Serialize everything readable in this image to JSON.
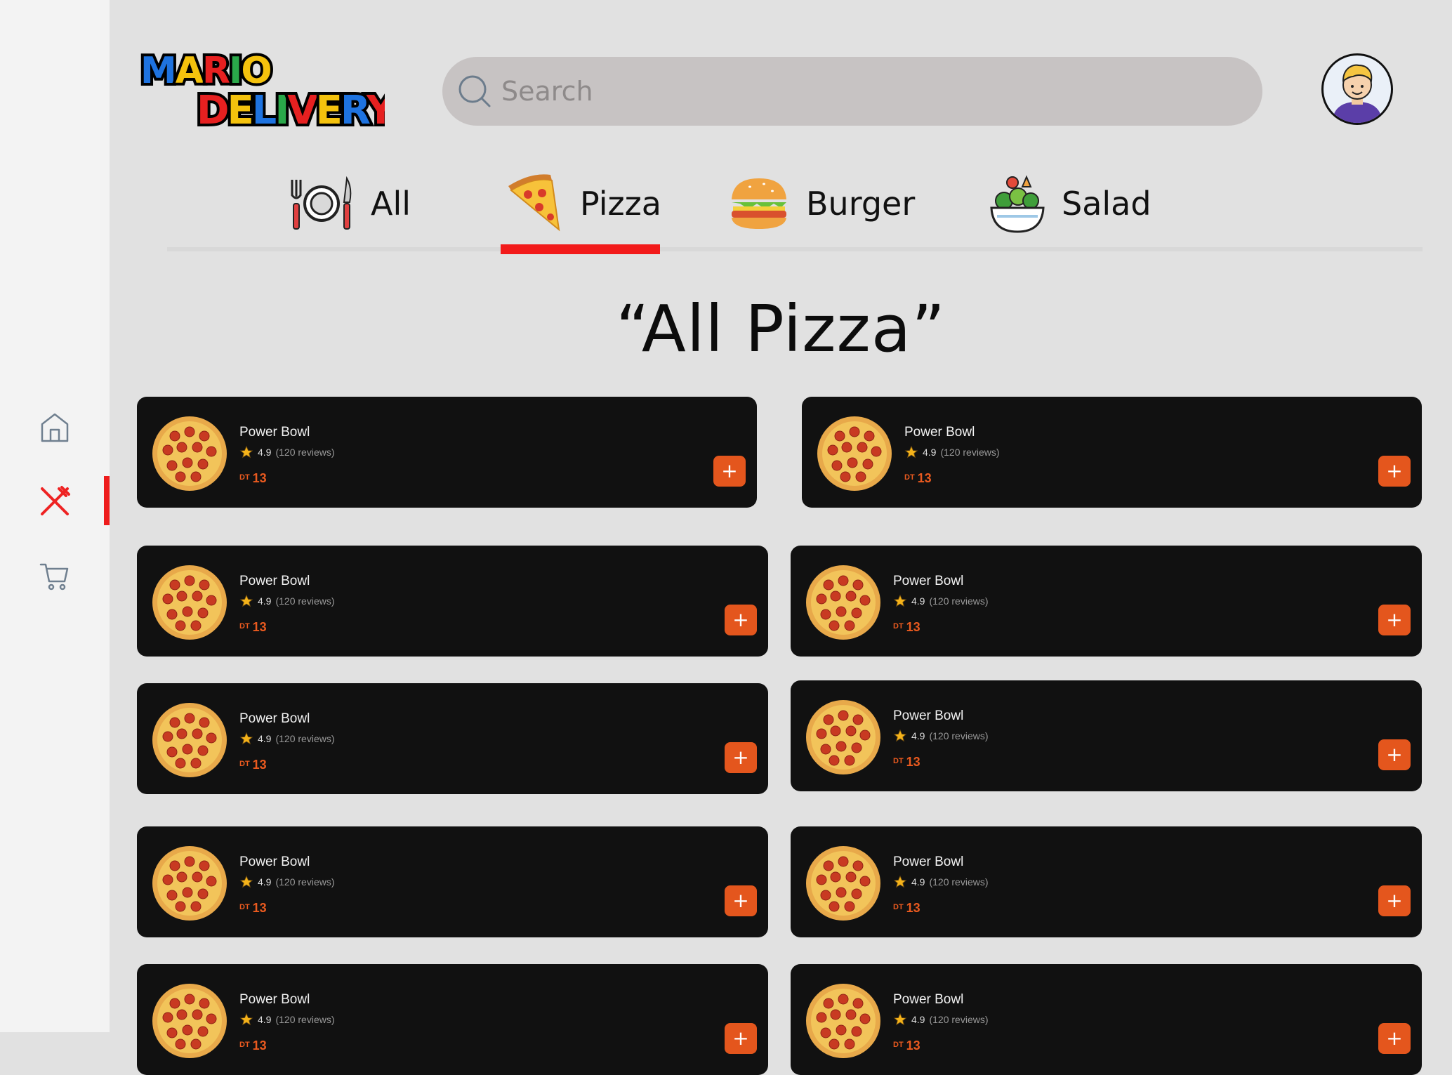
{
  "app": {
    "logo_line1": "MARIO",
    "logo_line2": "DELIVERY"
  },
  "search": {
    "placeholder": "Search"
  },
  "tabs": [
    {
      "label": "All",
      "icon": "plate-cutlery-icon"
    },
    {
      "label": "Pizza",
      "icon": "pizza-slice-icon",
      "active": true
    },
    {
      "label": "Burger",
      "icon": "burger-icon"
    },
    {
      "label": "Salad",
      "icon": "salad-bowl-icon"
    }
  ],
  "page_title": "“All Pizza”",
  "sidebar": {
    "items": [
      "home-icon",
      "cutlery-icon",
      "cart-icon"
    ],
    "active": "cutlery-icon"
  },
  "products": [
    {
      "name": "Power Bowl",
      "rating": "4.9",
      "reviews": "(120 reviews)",
      "currency": "DT",
      "price": "13",
      "add": "+"
    },
    {
      "name": "Power Bowl",
      "rating": "4.9",
      "reviews": "(120 reviews)",
      "currency": "DT",
      "price": "13",
      "add": "+"
    },
    {
      "name": "Power Bowl",
      "rating": "4.9",
      "reviews": "(120 reviews)",
      "currency": "DT",
      "price": "13",
      "add": "+"
    },
    {
      "name": "Power Bowl",
      "rating": "4.9",
      "reviews": "(120 reviews)",
      "currency": "DT",
      "price": "13",
      "add": "+"
    },
    {
      "name": "Power Bowl",
      "rating": "4.9",
      "reviews": "(120 reviews)",
      "currency": "DT",
      "price": "13",
      "add": "+"
    },
    {
      "name": "Power Bowl",
      "rating": "4.9",
      "reviews": "(120 reviews)",
      "currency": "DT",
      "price": "13",
      "add": "+"
    },
    {
      "name": "Power Bowl",
      "rating": "4.9",
      "reviews": "(120 reviews)",
      "currency": "DT",
      "price": "13",
      "add": "+"
    },
    {
      "name": "Power Bowl",
      "rating": "4.9",
      "reviews": "(120 reviews)",
      "currency": "DT",
      "price": "13",
      "add": "+"
    },
    {
      "name": "Power Bowl",
      "rating": "4.9",
      "reviews": "(120 reviews)",
      "currency": "DT",
      "price": "13",
      "add": "+"
    },
    {
      "name": "Power Bowl",
      "rating": "4.9",
      "reviews": "(120 reviews)",
      "currency": "DT",
      "price": "13",
      "add": "+"
    }
  ],
  "colors": {
    "accent": "#e4561d",
    "active": "#f21a1a",
    "card": "#111111"
  }
}
